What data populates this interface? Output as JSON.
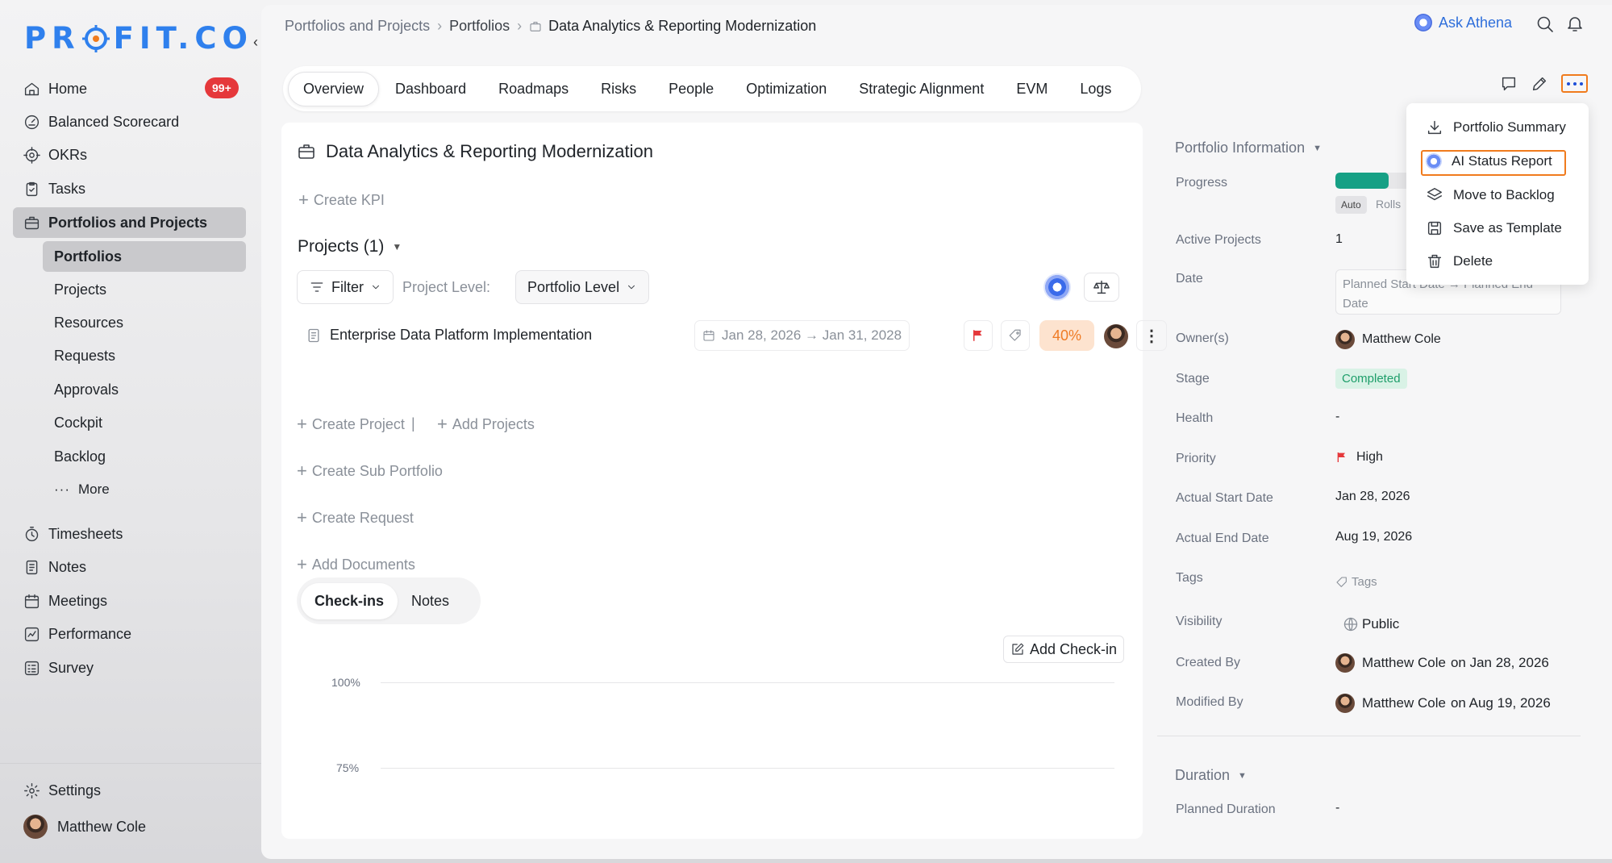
{
  "app": {
    "logo_text": "PR",
    "logo_text2": "FIT.CO",
    "brand_color": "#2f80ed"
  },
  "sidebar": {
    "items": [
      {
        "label": "Home",
        "icon": "home-icon",
        "badge": "99+"
      },
      {
        "label": "Balanced Scorecard",
        "icon": "scorecard-icon"
      },
      {
        "label": "OKRs",
        "icon": "target-icon"
      },
      {
        "label": "Tasks",
        "icon": "clipboard-check-icon"
      },
      {
        "label": "Portfolios and Projects",
        "icon": "briefcase-icon",
        "active": true
      }
    ],
    "sub_items": [
      {
        "label": "Portfolios",
        "active": true
      },
      {
        "label": "Projects"
      },
      {
        "label": "Resources"
      },
      {
        "label": "Requests"
      },
      {
        "label": "Approvals"
      },
      {
        "label": "Cockpit"
      },
      {
        "label": "Backlog"
      },
      {
        "label": "More"
      }
    ],
    "items2": [
      {
        "label": "Timesheets",
        "icon": "stopwatch-icon"
      },
      {
        "label": "Notes",
        "icon": "notes-icon"
      },
      {
        "label": "Meetings",
        "icon": "calendar-icon"
      },
      {
        "label": "Performance",
        "icon": "chart-icon"
      },
      {
        "label": "Survey",
        "icon": "survey-icon"
      }
    ],
    "settings": "Settings",
    "user": "Matthew Cole"
  },
  "breadcrumb": [
    "Portfolios and Projects",
    "Portfolios",
    "Data Analytics & Reporting Modernization"
  ],
  "header": {
    "ask": "Ask Athena"
  },
  "tabs": [
    "Overview",
    "Dashboard",
    "Roadmaps",
    "Risks",
    "People",
    "Optimization",
    "Strategic Alignment",
    "EVM",
    "Logs"
  ],
  "card": {
    "title": "Data Analytics & Reporting Modernization",
    "create_kpi": "Create KPI",
    "projects_head": "Projects (1)",
    "filter": "Filter",
    "project_level_label": "Project Level:",
    "project_level_value": "Portfolio Level",
    "project": {
      "name": "Enterprise Data Platform Implementation",
      "dates": "Jan 28, 2026 → Jan 31, 2028",
      "percent": "40%"
    },
    "create_project": "Create Project",
    "add_projects": "Add Projects",
    "create_sub_portfolio": "Create Sub Portfolio",
    "create_request": "Create Request",
    "add_documents": "Add Documents",
    "checkins_tab": "Check-ins",
    "notes_tab": "Notes",
    "add_checkin": "Add Check-in",
    "chart_labels": [
      "100%",
      "75%"
    ]
  },
  "panel": {
    "info_head": "Portfolio Information",
    "progress_label": "Progress",
    "progress_value": 0.3,
    "auto": "Auto",
    "rolls": "Rolls",
    "active_projects_label": "Active Projects",
    "active_projects": "1",
    "date_label": "Date",
    "date_placeholder_1": "Planned Start Date → Planned End",
    "date_placeholder_2": "Date",
    "owners_label": "Owner(s)",
    "owner": "Matthew Cole",
    "stage_label": "Stage",
    "stage": "Completed",
    "health_label": "Health",
    "health": "-",
    "priority_label": "Priority",
    "priority": "High",
    "actual_start_label": "Actual Start Date",
    "actual_start": "Jan 28, 2026",
    "actual_end_label": "Actual End Date",
    "actual_end": "Aug 19, 2026",
    "tags_label": "Tags",
    "tags": "Tags",
    "visibility_label": "Visibility",
    "visibility": "Public",
    "created_by_label": "Created By",
    "created_by": "Matthew Cole",
    "created_on": "on Jan 28, 2026",
    "modified_by_label": "Modified By",
    "modified_by": "Matthew Cole",
    "modified_on": "on Aug 19, 2026",
    "duration_head": "Duration",
    "planned_duration_label": "Planned Duration",
    "planned_duration": "-"
  },
  "menu": {
    "items": [
      "Portfolio Summary",
      "AI Status Report",
      "Move to Backlog",
      "Save as Template",
      "Delete"
    ]
  }
}
